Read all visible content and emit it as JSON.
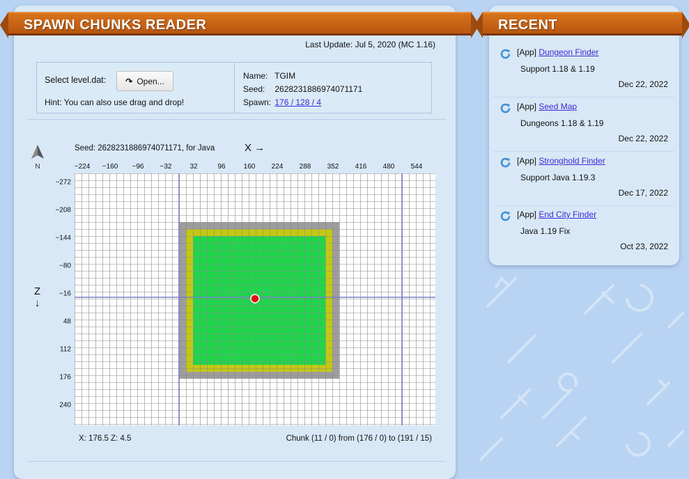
{
  "app": {
    "title": "SPAWN CHUNKS READER",
    "last_update": "Last Update: Jul 5, 2020 (MC 1.16)"
  },
  "loader": {
    "select_label": "Select level.dat:",
    "open_button": "Open...",
    "hint": "Hint: You can also use drag and drop!"
  },
  "world": {
    "name_label": "Name:",
    "name": "TGIM",
    "seed_label": "Seed:",
    "seed": "2628231886974071171",
    "spawn_label": "Spawn:",
    "spawn": "176 / 128 / 4"
  },
  "map": {
    "compass_letter": "N",
    "seed_caption": "Seed: 2628231886974071171, for Java",
    "x_axis": "X →",
    "z_axis": "Z",
    "z_arrow": "↓",
    "x_ticks": [
      "−224",
      "−160",
      "−96",
      "−32",
      "32",
      "96",
      "160",
      "224",
      "288",
      "352",
      "416",
      "480",
      "544"
    ],
    "z_ticks": [
      "−272",
      "−208",
      "−144",
      "−80",
      "−16",
      "48",
      "112",
      "176",
      "240"
    ],
    "coords": "X: 176.5   Z: 4.5",
    "chunk_info": "Chunk (11 / 0) from (176 / 0) to (191 / 15)",
    "colors": {
      "gray": "#9d9d9d",
      "yellow": "#c5c810",
      "green": "#1ed64a",
      "marker": "#e01010",
      "axis": "#7d7fc4",
      "grid": "#8a8a8a"
    }
  },
  "recent": {
    "title": "RECENT",
    "items": [
      {
        "tag": "[App]",
        "name": "Dungeon Finder",
        "sub": "Support 1.18 & 1.19",
        "date": "Dec 22, 2022"
      },
      {
        "tag": "[App]",
        "name": "Seed Map",
        "sub": "Dungeons 1.18 & 1.19",
        "date": "Dec 22, 2022"
      },
      {
        "tag": "[App]",
        "name": "Stronghold Finder",
        "sub": "Support Java 1.19.3",
        "date": "Dec 17, 2022"
      },
      {
        "tag": "[App]",
        "name": "End City Finder",
        "sub": "Java 1.19 Fix",
        "date": "Oct 23, 2022"
      }
    ]
  }
}
